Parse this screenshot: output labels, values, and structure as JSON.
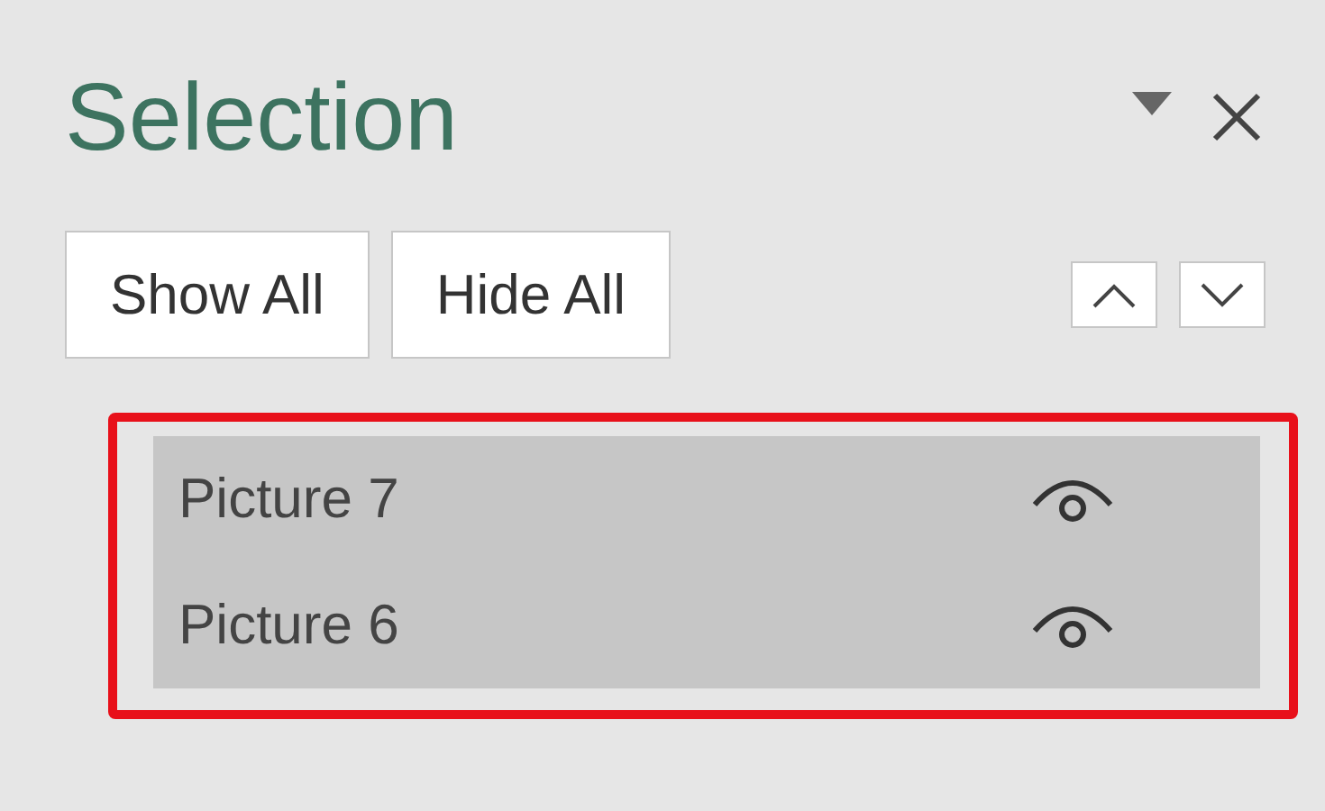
{
  "panel": {
    "title": "Selection"
  },
  "buttons": [
    {
      "label": "Show All"
    },
    {
      "label": "Hide All"
    }
  ],
  "items": [
    {
      "name": "Picture 7",
      "selected": true,
      "visible": true
    },
    {
      "name": "Picture 6",
      "selected": true,
      "visible": true
    }
  ],
  "highlight": {
    "color": "#e8101a"
  }
}
